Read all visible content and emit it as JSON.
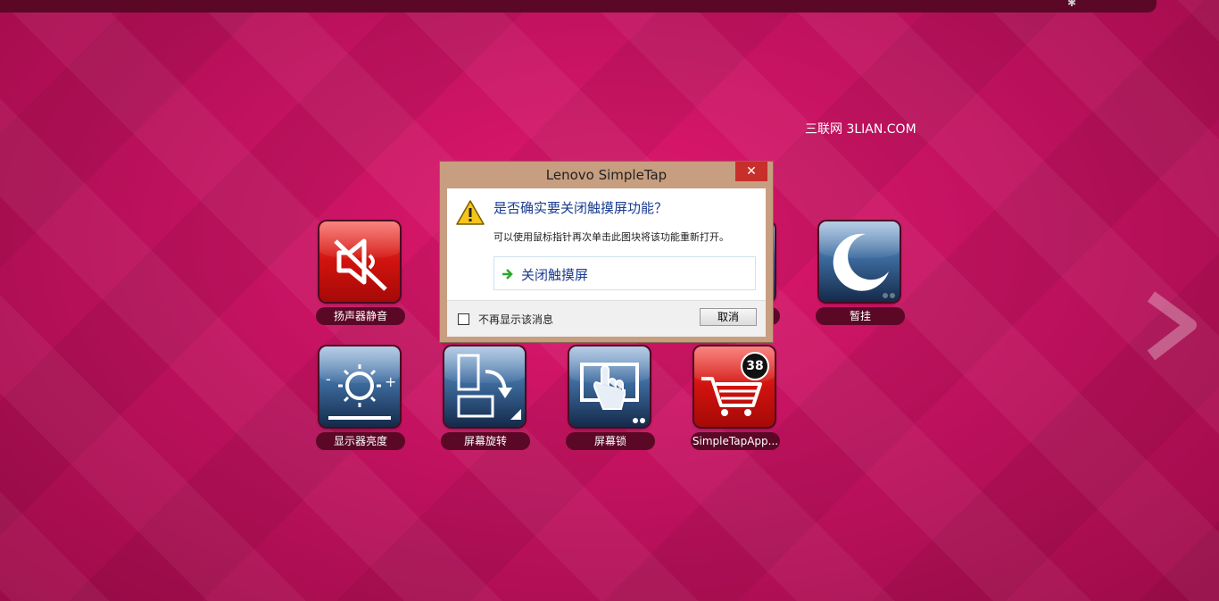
{
  "topbar": {
    "icon": "pin-icon"
  },
  "watermark": "三联网 3LIAN.COM",
  "tiles": [
    {
      "label": "扬声器静音",
      "color": "red",
      "icon": "speaker-mute-icon"
    },
    {
      "label": "",
      "color": "blue",
      "icon": "hidden-tile-icon"
    },
    {
      "label": "",
      "color": "blue",
      "icon": "hidden-tile-icon"
    },
    {
      "label": "",
      "color": "blue",
      "icon": "hidden-tile-icon"
    },
    {
      "label": "暂挂",
      "color": "blue",
      "icon": "moon-icon"
    },
    {
      "label": "显示器亮度",
      "color": "blue",
      "icon": "brightness-icon"
    },
    {
      "label": "屏幕旋转",
      "color": "blue",
      "icon": "rotate-screen-icon"
    },
    {
      "label": "屏幕锁",
      "color": "blue",
      "icon": "screen-lock-icon"
    },
    {
      "label": "SimpleTapApp...",
      "color": "red",
      "icon": "shopping-cart-icon",
      "badge": "38"
    }
  ],
  "dialog": {
    "title": "Lenovo SimpleTap",
    "close_label": "✕",
    "heading": "是否确实要关闭触摸屏功能？",
    "subtext": "可以使用鼠标指针再次单击此图块将该功能重新打开。",
    "command_label": "关闭触摸屏",
    "checkbox_label": "不再显示该消息",
    "cancel_label": "取消"
  },
  "colors": {
    "background": "#c21260",
    "tile_red": "#d0120e",
    "tile_blue": "#3d6b9e",
    "label_bg": "#5a0826"
  }
}
